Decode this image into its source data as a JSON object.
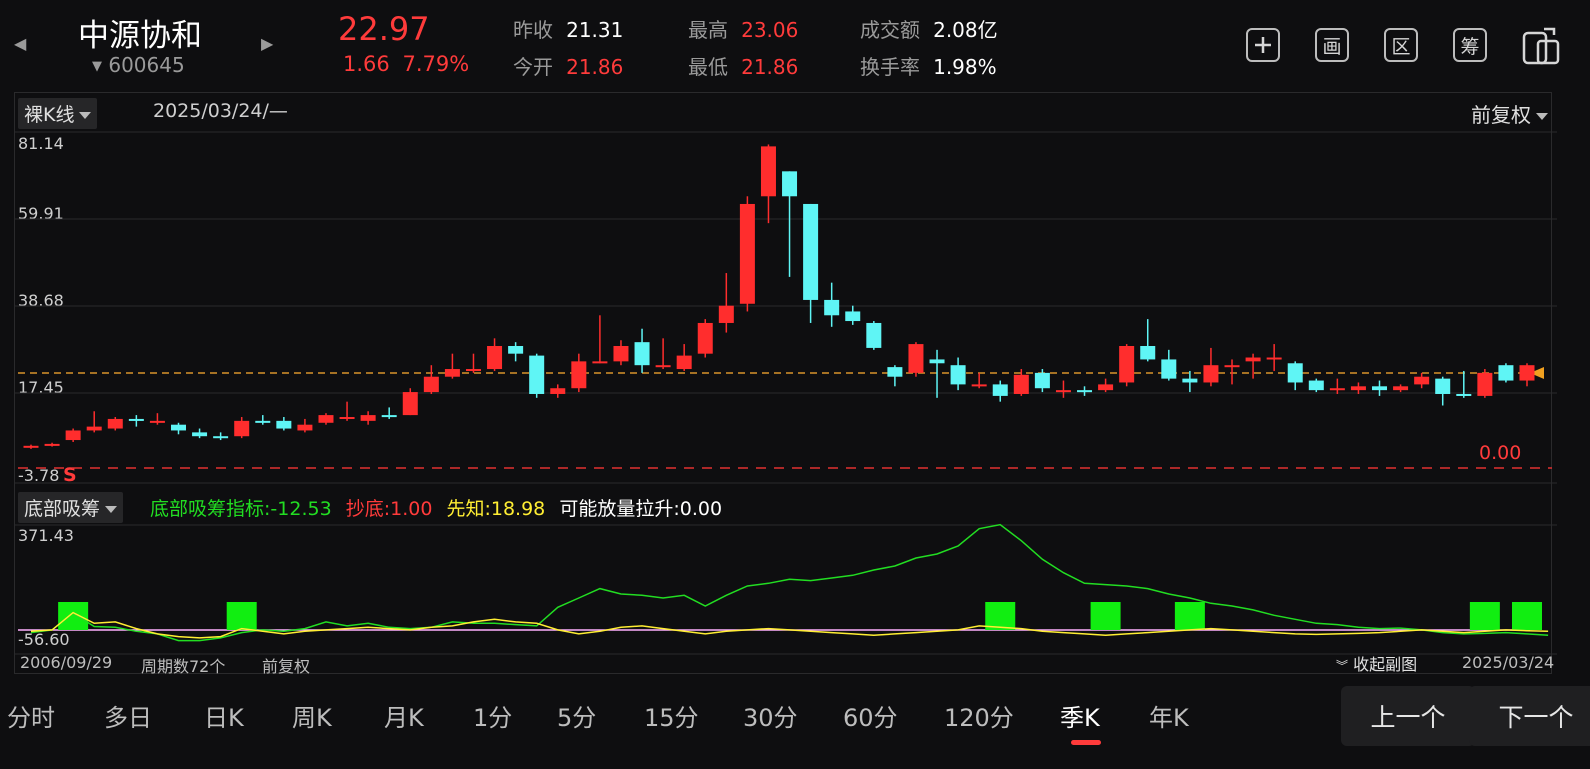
{
  "header": {
    "stock_name": "中源协和",
    "stock_code": "600645",
    "price": "22.97",
    "change": "1.66",
    "change_pct": "7.79%",
    "quotes": [
      {
        "label": "昨收",
        "value": "21.31"
      },
      {
        "label": "今开",
        "value": "21.86"
      },
      {
        "label": "最高",
        "value": "23.06"
      },
      {
        "label": "最低",
        "value": "21.86"
      },
      {
        "label": "成交额",
        "value": "2.08亿"
      },
      {
        "label": "换手率",
        "value": "1.98%"
      }
    ],
    "tools": [
      "加",
      "画",
      "区",
      "筹"
    ],
    "tool_icons": [
      "plus-icon",
      "draw-icon",
      "region-icon",
      "chips-icon",
      "device-switch-icon"
    ]
  },
  "main_chart": {
    "mode_label": "裸K线",
    "cursor_date": "2025/03/24/—",
    "adjust_label": "前复权",
    "y_labels": [
      "81.14",
      "59.91",
      "38.68",
      "17.45",
      "-3.78"
    ],
    "zero_label": "0.00",
    "s_marker": "S"
  },
  "indicator": {
    "name": "底部吸筹",
    "items": [
      {
        "label": "底部吸筹指标:",
        "value": "-12.53",
        "color": "#22dd22"
      },
      {
        "label": "抄底:",
        "value": "1.00",
        "color": "#ff3b3b"
      },
      {
        "label": "先知:",
        "value": "18.98",
        "color": "#ffee33"
      },
      {
        "label": "可能放量拉升:",
        "value": "0.00",
        "color": "#ffffff"
      }
    ],
    "y_max": "371.43",
    "y_min": "-56.60"
  },
  "footer": {
    "start_date": "2006/09/29",
    "period_count": "周期数72个",
    "adjust": "前复权",
    "collapse": "收起副图",
    "end_date": "2025/03/24"
  },
  "tabs": [
    "分时",
    "多日",
    "日K",
    "周K",
    "月K",
    "1分",
    "5分",
    "15分",
    "30分",
    "60分",
    "120分",
    "季K",
    "年K"
  ],
  "active_tab": "季K",
  "buttons": {
    "prev": "上一个",
    "next": "下一个"
  },
  "chart_data": {
    "type": "candlestick",
    "period": "quarterly",
    "ylim": [
      -3.78,
      81.14
    ],
    "reference_price": 22.97,
    "candles": [
      {
        "o": 1.5,
        "c": 2.0,
        "h": 2.3,
        "l": 1.2
      },
      {
        "o": 2.0,
        "c": 2.5,
        "h": 2.8,
        "l": 1.8
      },
      {
        "o": 3.5,
        "c": 6.0,
        "h": 6.5,
        "l": 3.0
      },
      {
        "o": 6.0,
        "c": 7.0,
        "h": 11.0,
        "l": 5.5
      },
      {
        "o": 6.5,
        "c": 9.0,
        "h": 9.5,
        "l": 6.0
      },
      {
        "o": 9.0,
        "c": 8.5,
        "h": 10.0,
        "l": 7.0
      },
      {
        "o": 8.5,
        "c": 8.5,
        "h": 10.5,
        "l": 7.5
      },
      {
        "o": 7.5,
        "c": 6.0,
        "h": 8.0,
        "l": 5.0
      },
      {
        "o": 5.5,
        "c": 4.5,
        "h": 6.5,
        "l": 4.0
      },
      {
        "o": 4.5,
        "c": 4.0,
        "h": 5.5,
        "l": 3.5
      },
      {
        "o": 4.5,
        "c": 8.5,
        "h": 9.5,
        "l": 4.0
      },
      {
        "o": 8.5,
        "c": 8.0,
        "h": 10.0,
        "l": 7.5
      },
      {
        "o": 8.5,
        "c": 6.5,
        "h": 9.5,
        "l": 6.0
      },
      {
        "o": 6.0,
        "c": 7.5,
        "h": 9.0,
        "l": 5.5
      },
      {
        "o": 8.0,
        "c": 10.0,
        "h": 10.5,
        "l": 7.5
      },
      {
        "o": 9.0,
        "c": 9.5,
        "h": 13.5,
        "l": 8.5
      },
      {
        "o": 8.5,
        "c": 10.0,
        "h": 11.0,
        "l": 7.5
      },
      {
        "o": 10.0,
        "c": 9.5,
        "h": 12.0,
        "l": 9.0
      },
      {
        "o": 10.0,
        "c": 16.0,
        "h": 17.0,
        "l": 10.0
      },
      {
        "o": 16.0,
        "c": 20.0,
        "h": 23.0,
        "l": 15.5
      },
      {
        "o": 20.0,
        "c": 22.0,
        "h": 26.0,
        "l": 19.5
      },
      {
        "o": 22.0,
        "c": 22.0,
        "h": 26.0,
        "l": 21.0
      },
      {
        "o": 22.0,
        "c": 28.0,
        "h": 30.0,
        "l": 21.5
      },
      {
        "o": 28.0,
        "c": 26.0,
        "h": 29.0,
        "l": 24.0
      },
      {
        "o": 25.5,
        "c": 15.5,
        "h": 26.0,
        "l": 14.5
      },
      {
        "o": 15.5,
        "c": 17.0,
        "h": 18.0,
        "l": 14.5
      },
      {
        "o": 17.0,
        "c": 24.0,
        "h": 26.0,
        "l": 16.0
      },
      {
        "o": 24.0,
        "c": 24.0,
        "h": 36.0,
        "l": 23.5
      },
      {
        "o": 24.0,
        "c": 28.0,
        "h": 29.5,
        "l": 23.0
      },
      {
        "o": 29.0,
        "c": 23.0,
        "h": 32.5,
        "l": 21.0
      },
      {
        "o": 23.0,
        "c": 23.0,
        "h": 30.0,
        "l": 22.0
      },
      {
        "o": 22.0,
        "c": 25.5,
        "h": 28.5,
        "l": 21.5
      },
      {
        "o": 26.0,
        "c": 34.0,
        "h": 35.0,
        "l": 25.0
      },
      {
        "o": 34.0,
        "c": 38.5,
        "h": 47.0,
        "l": 31.5
      },
      {
        "o": 39.0,
        "c": 65.0,
        "h": 67.0,
        "l": 37.0
      },
      {
        "o": 67.0,
        "c": 80.0,
        "h": 80.5,
        "l": 60.0
      },
      {
        "o": 73.5,
        "c": 67.0,
        "h": 73.5,
        "l": 46.0
      },
      {
        "o": 65.0,
        "c": 40.0,
        "h": 65.0,
        "l": 34.0
      },
      {
        "o": 40.0,
        "c": 36.0,
        "h": 44.5,
        "l": 33.0
      },
      {
        "o": 37.0,
        "c": 34.5,
        "h": 38.5,
        "l": 33.5
      },
      {
        "o": 34.0,
        "c": 27.5,
        "h": 34.5,
        "l": 27.0
      },
      {
        "o": 22.5,
        "c": 20.0,
        "h": 23.0,
        "l": 17.5
      },
      {
        "o": 21.0,
        "c": 28.5,
        "h": 29.0,
        "l": 20.0
      },
      {
        "o": 24.5,
        "c": 23.5,
        "h": 27.0,
        "l": 14.5
      },
      {
        "o": 23.0,
        "c": 18.0,
        "h": 25.0,
        "l": 16.5
      },
      {
        "o": 18.0,
        "c": 18.0,
        "h": 21.0,
        "l": 17.0
      },
      {
        "o": 18.0,
        "c": 15.0,
        "h": 19.0,
        "l": 13.5
      },
      {
        "o": 15.5,
        "c": 20.5,
        "h": 22.0,
        "l": 15.0
      },
      {
        "o": 21.0,
        "c": 17.0,
        "h": 22.0,
        "l": 16.0
      },
      {
        "o": 16.5,
        "c": 16.5,
        "h": 19.0,
        "l": 14.5
      },
      {
        "o": 16.5,
        "c": 16.0,
        "h": 17.5,
        "l": 15.0
      },
      {
        "o": 16.5,
        "c": 18.0,
        "h": 19.5,
        "l": 16.0
      },
      {
        "o": 18.5,
        "c": 28.0,
        "h": 28.5,
        "l": 17.5
      },
      {
        "o": 28.0,
        "c": 24.5,
        "h": 35.0,
        "l": 24.0
      },
      {
        "o": 24.5,
        "c": 19.5,
        "h": 27.0,
        "l": 19.0
      },
      {
        "o": 19.5,
        "c": 18.5,
        "h": 21.5,
        "l": 16.0
      },
      {
        "o": 18.5,
        "c": 23.0,
        "h": 27.5,
        "l": 17.5
      },
      {
        "o": 23.0,
        "c": 23.0,
        "h": 24.5,
        "l": 18.0
      },
      {
        "o": 24.0,
        "c": 25.0,
        "h": 26.0,
        "l": 19.5
      },
      {
        "o": 25.0,
        "c": 25.0,
        "h": 28.5,
        "l": 21.5
      },
      {
        "o": 23.5,
        "c": 18.5,
        "h": 24.0,
        "l": 16.5
      },
      {
        "o": 19.0,
        "c": 16.5,
        "h": 19.5,
        "l": 16.0
      },
      {
        "o": 17.0,
        "c": 17.0,
        "h": 19.5,
        "l": 15.5
      },
      {
        "o": 16.5,
        "c": 17.5,
        "h": 18.5,
        "l": 15.5
      },
      {
        "o": 17.5,
        "c": 16.5,
        "h": 19.0,
        "l": 15.0
      },
      {
        "o": 16.5,
        "c": 17.5,
        "h": 18.0,
        "l": 16.0
      },
      {
        "o": 18.0,
        "c": 20.0,
        "h": 21.0,
        "l": 17.0
      },
      {
        "o": 19.5,
        "c": 15.5,
        "h": 20.0,
        "l": 12.5
      },
      {
        "o": 15.5,
        "c": 15.0,
        "h": 21.5,
        "l": 14.5
      },
      {
        "o": 15.0,
        "c": 21.0,
        "h": 22.0,
        "l": 14.5
      },
      {
        "o": 23.0,
        "c": 19.0,
        "h": 23.5,
        "l": 18.5
      },
      {
        "o": 19.0,
        "c": 23.0,
        "h": 23.5,
        "l": 17.5
      }
    ],
    "indicator": {
      "ylim": [
        -56.6,
        371.43
      ],
      "series": [
        {
          "name": "底部吸筹指标",
          "color": "#22dd22",
          "values": [
            -25,
            -15,
            48,
            -2,
            -5,
            -20,
            -30,
            -55,
            -55,
            -45,
            -25,
            -15,
            -20,
            -10,
            15,
            0,
            10,
            -5,
            -10,
            -5,
            15,
            10,
            10,
            5,
            0,
            70,
            105,
            140,
            120,
            115,
            105,
            115,
            75,
            115,
            150,
            160,
            175,
            170,
            180,
            190,
            210,
            225,
            255,
            270,
            300,
            365,
            380,
            320,
            250,
            200,
            160,
            155,
            150,
            140,
            120,
            105,
            85,
            75,
            60,
            40,
            25,
            10,
            5,
            -5,
            -10,
            -8,
            -15,
            -25,
            -30,
            -28,
            -25,
            -30,
            -35
          ]
        },
        {
          "name": "先知",
          "color": "#ffee33",
          "values": [
            -20,
            -15,
            50,
            10,
            15,
            -10,
            -30,
            -40,
            -45,
            -40,
            -10,
            -20,
            -30,
            -20,
            -15,
            -10,
            -5,
            -10,
            -15,
            -5,
            0,
            15,
            25,
            15,
            10,
            -15,
            -30,
            -20,
            -5,
            0,
            -10,
            -20,
            -30,
            -20,
            -15,
            -10,
            -15,
            -20,
            -25,
            -30,
            -35,
            -30,
            -25,
            -20,
            -15,
            0,
            -5,
            -10,
            -20,
            -25,
            -30,
            -35,
            -30,
            -25,
            -20,
            -15,
            -10,
            -15,
            -20,
            -25,
            -30,
            -32,
            -30,
            -28,
            -25,
            -20,
            -15,
            -20,
            -25,
            -20,
            -15,
            -18,
            -20
          ]
        }
      ],
      "bars_at": [
        2,
        10,
        46,
        51,
        55,
        69,
        71
      ]
    }
  }
}
